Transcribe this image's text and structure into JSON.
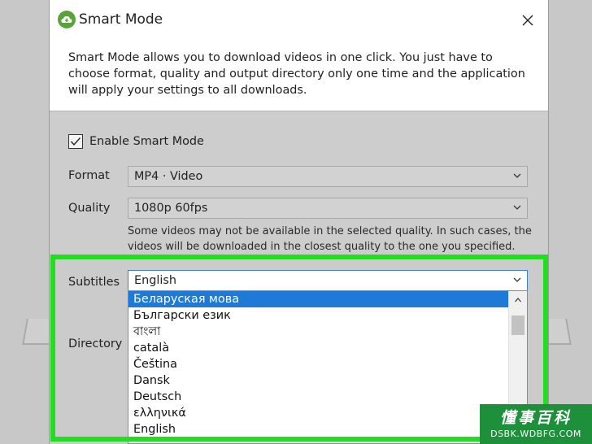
{
  "dialog": {
    "title": "Smart Mode",
    "description": "Smart Mode allows you to download videos in one click. You just have to choose format, quality and output directory only one time and the application will apply your settings to all downloads."
  },
  "enable_smart_mode": {
    "label": "Enable Smart Mode",
    "checked": true
  },
  "format": {
    "label": "Format",
    "value": "MP4 · Video"
  },
  "quality": {
    "label": "Quality",
    "value": "1080p 60fps",
    "note": "Some videos may not be available in the selected quality. In such cases, the videos will be downloaded in the closest quality to the one you specified."
  },
  "subtitles": {
    "label": "Subtitles",
    "value": "English",
    "options": [
      "Беларуская мова",
      "Български език",
      "বাংলা",
      "català",
      "Čeština",
      "Dansk",
      "Deutsch",
      "ελληνικά",
      "English"
    ],
    "highlighted_index": 0
  },
  "directory": {
    "label": "Directory"
  },
  "watermark": {
    "chinese": "懂事百科",
    "url": "DSBK.WDBFG.COM"
  },
  "colors": {
    "highlight_box": "#22dd22",
    "selection": "#1f79d6",
    "watermark_bg": "#1e8f3a",
    "app_icon": "#5aa33a"
  }
}
